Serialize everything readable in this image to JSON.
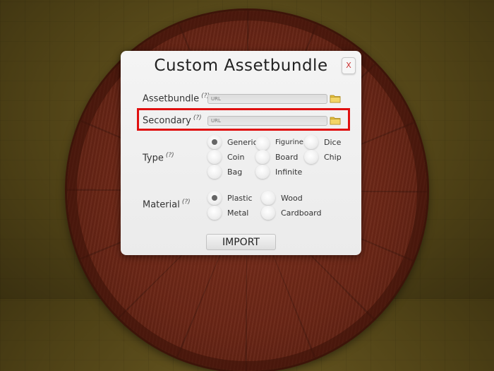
{
  "dialog": {
    "title": "Custom Assetbundle",
    "close_label": "X",
    "import_label": "IMPORT"
  },
  "fields": {
    "assetbundle": {
      "label": "Assetbundle",
      "hint": "(?)",
      "placeholder": "URL"
    },
    "secondary": {
      "label": "Secondary",
      "hint": "(?)",
      "placeholder": "URL"
    }
  },
  "type": {
    "label": "Type",
    "hint": "(?)",
    "options": [
      "Generic",
      "Figurine",
      "Dice",
      "Coin",
      "Board",
      "Chip",
      "Bag",
      "Infinite"
    ],
    "selected": "Generic"
  },
  "material": {
    "label": "Material",
    "hint": "(?)",
    "options": [
      "Plastic",
      "Wood",
      "Metal",
      "Cardboard"
    ],
    "selected": "Plastic"
  },
  "icons": {
    "folder": "folder-icon",
    "close": "close-icon"
  },
  "colors": {
    "highlight": "#e01010",
    "folder": "#e8c33a"
  }
}
